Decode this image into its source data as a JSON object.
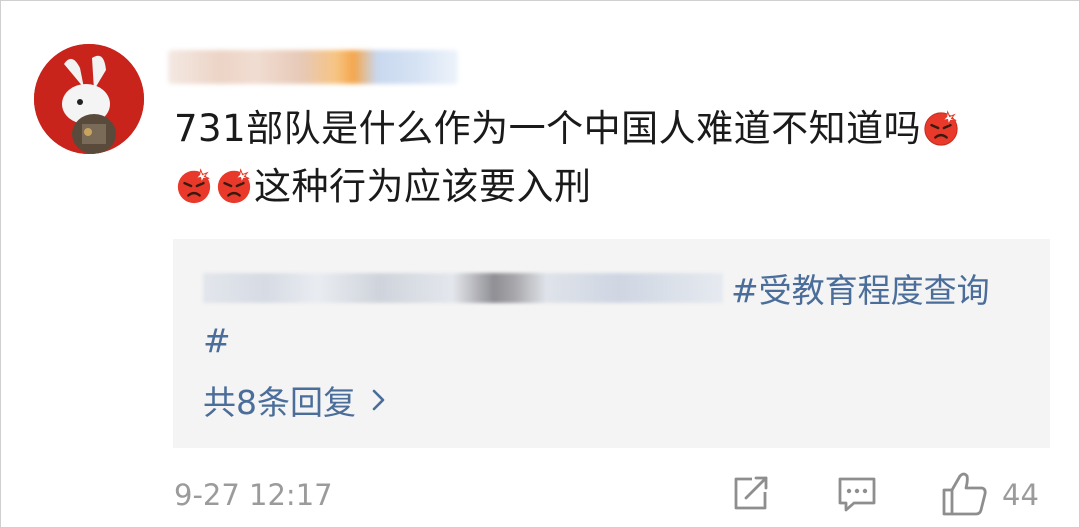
{
  "comment": {
    "username": "",
    "text_line1": "731部队是什么作为一个中国人难道不知道吗",
    "text_line2": "这种行为应该要入刑",
    "emoji_name": "angry-face-emoji"
  },
  "reply_preview": {
    "hashtag_start": "#受教育程度查询",
    "hashtag_end": "#",
    "reply_count_label": "共8条回复"
  },
  "footer": {
    "timestamp": "9-27 12:17",
    "like_count": "44"
  },
  "colors": {
    "link": "#4a6d99",
    "meta": "#9b9b9b",
    "reply_bg": "#f4f4f4"
  }
}
